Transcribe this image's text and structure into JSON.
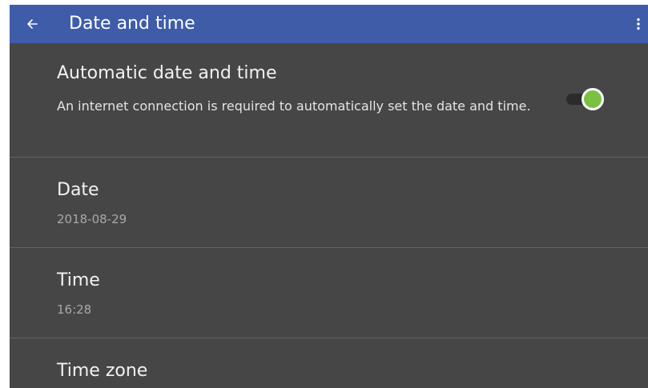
{
  "header": {
    "title": "Date and time",
    "back_icon": "arrow-back-icon",
    "menu_icon": "more-vert-icon"
  },
  "settings": {
    "automatic": {
      "title": "Automatic date and time",
      "description": "An internet connection is required to automatically set the date and time.",
      "enabled": true
    },
    "date": {
      "title": "Date",
      "value": "2018-08-29"
    },
    "time": {
      "title": "Time",
      "value": "16:28"
    },
    "time_zone": {
      "title": "Time zone"
    }
  },
  "colors": {
    "app_bar": "#3f5ca9",
    "background": "#464646",
    "toggle_on": "#7bc043"
  }
}
